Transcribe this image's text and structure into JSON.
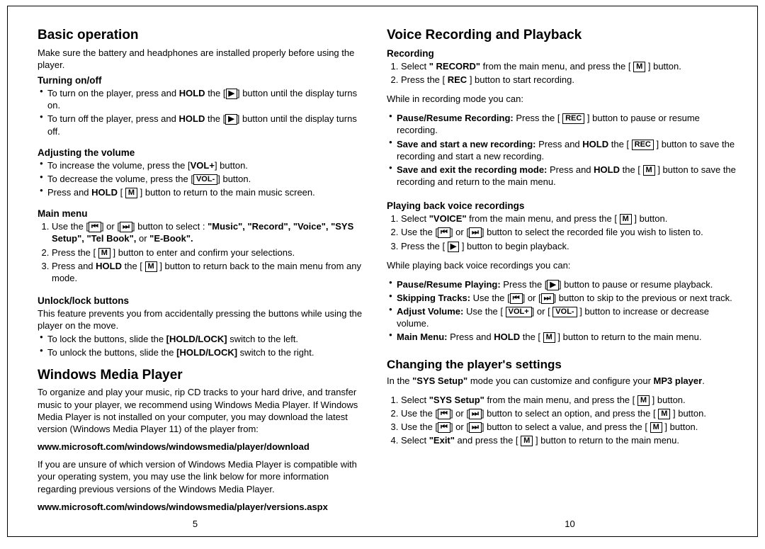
{
  "left": {
    "title": "Basic operation",
    "intro": "Make sure the battery and headphones are installed properly before using the player.",
    "turning_h": "Turning on/off",
    "turning_on_a": "To turn on the player, press and ",
    "turning_on_b": " the [",
    "turning_on_c": "] button until the display turns on.",
    "turning_off_a": "To turn off the player, press and ",
    "turning_off_b": " the [",
    "turning_off_c": "] button until the display turns off.",
    "hold": "HOLD",
    "volume_h": "Adjusting the volume",
    "vol_inc_a": "To increase the volume, press the [",
    "vol_inc_b": "] button.",
    "vol_dec_a": "To decrease the volume, press the [",
    "vol_dec_b": "] button.",
    "vol_plus": "VOL+",
    "vol_minus": "VOL-",
    "vol_hold_a": "Press and ",
    "vol_hold_b": " [ ",
    "vol_hold_c": " ] button to return to the main music screen.",
    "m_btn": "M",
    "mainmenu_h": "Main menu",
    "mm_1a": "Use the [",
    "mm_1b": "] or [",
    "mm_1c": "] button to select : ",
    "mm_1d": "\"Music\", \"Record\", \"Voice\", \"SYS Setup\", \"Tel Book\",",
    "mm_1e": " or ",
    "mm_1f": "\"E-Book\".",
    "mm_2a": "Press the [ ",
    "mm_2b": " ] button to enter and confirm your selections.",
    "mm_3a": "Press and ",
    "mm_3b": " the [ ",
    "mm_3c": " ] button to return back to the main menu from any mode.",
    "lock_h": "Unlock/lock buttons",
    "lock_desc": "This feature prevents you from accidentally pressing the buttons while using the player on the move.",
    "lock_1a": "To lock the buttons, slide the ",
    "lock_1b": "[HOLD/LOCK]",
    "lock_1c": " switch to the left.",
    "lock_2a": "To unlock the buttons, slide the ",
    "lock_2c": " switch to the right.",
    "wmp_h": "Windows Media Player",
    "wmp_p1": "To organize and play your music, rip CD tracks to your hard drive, and transfer music to your player, we recommend using Windows Media Player.  If Windows Media Player is not installed on your computer, you may download the latest version (Windows Media Player 11) of the player from:",
    "wmp_link1": "www.microsoft.com/windows/windowsmedia/player/download",
    "wmp_p2": "If you are unsure of which version of Windows Media Player is compatible with your operating system, you may use the link below for more information regarding previous versions of the Windows Media Player.",
    "wmp_link2": "www.microsoft.com/windows/windowsmedia/player/versions.aspx",
    "page_number": "5"
  },
  "right": {
    "title": "Voice Recording and Playback",
    "rec_h": "Recording",
    "rec_1a": "Select ",
    "rec_1b": "\" RECORD\"",
    "rec_1c": " from the main menu, and press the  [ ",
    "rec_1d": " ] button.",
    "rec_2a": "Press the [ ",
    "rec_2b": "REC",
    "rec_2c": " ] button to start recording.",
    "rec_while": "While in recording mode you can:",
    "rec_b1_h": "Pause/Resume Recording: ",
    "rec_b1_a": "Press the [ ",
    "rec_b1_b": " ] button to pause or resume recording.",
    "rec_b2_h": "Save and start a new recording: ",
    "rec_b2_a": "Press and ",
    "rec_b2_b": " the [ ",
    "rec_b2_c": " ] button to save the recording and start a new recording.",
    "rec_b3_h": "Save and exit the recording mode: ",
    "rec_b3_a": "Press and ",
    "rec_b3_b": " the [ ",
    "rec_b3_c": " ] button to save the recording and return to the main menu.",
    "play_h": "Playing back voice recordings",
    "play_1a": "Select ",
    "play_1b": "\"VOICE\"",
    "play_1c": " from the main menu, and press the [ ",
    "play_1d": " ] button.",
    "play_2a": "Use the [",
    "play_2b": "] or [",
    "play_2c": "] button to select the recorded file you wish to listen to.",
    "play_3a": "Press the [ ",
    "play_3b": " ] button to begin playback.",
    "play_while": "While playing back voice recordings you can:",
    "pb_b1_h": "Pause/Resume Playing: ",
    "pb_b1_a": "Press the [",
    "pb_b1_b": "] button to pause or resume playback.",
    "pb_b2_h": "Skipping Tracks: ",
    "pb_b2_a": "Use the [",
    "pb_b2_b": "] or [",
    "pb_b2_c": "] button to skip to the previous or next track.",
    "pb_b3_h": "Adjust Volume: ",
    "pb_b3_a": "Use the [ ",
    "pb_b3_b": "] or [ ",
    "pb_b3_c": " ] button to increase or decrease volume.",
    "pb_b4_h": "Main Menu: ",
    "pb_b4_a": "Press and ",
    "pb_b4_b": " the [ ",
    "pb_b4_c": " ] button to return to the main menu.",
    "settings_h": "Changing the player's settings",
    "set_intro_a": "In the ",
    "set_intro_b": "\"SYS Setup\"",
    "set_intro_c": " mode you can customize and configure your ",
    "set_intro_d": "MP3 player",
    "set_intro_e": ".",
    "set_1a": "Select ",
    "set_1b": "\"SYS Setup\"",
    "set_1c": " from the main menu, and press the [ ",
    "set_1d": " ] button.",
    "set_2a": "Use the [",
    "set_2b": "] or [",
    "set_2c": "] button to select an option, and press the [ ",
    "set_2d": " ] button.",
    "set_3a": "Use the [",
    "set_3b": "] or [",
    "set_3c": "] button to select a value, and press the [ ",
    "set_3d": " ] button.",
    "set_4a": "Select ",
    "set_4b": "\"Exit\"",
    "set_4c": " and press the [ ",
    "set_4d": " ] button to return to the main menu.",
    "page_number": "10"
  },
  "icons": {
    "play": "▶",
    "prev": "⏮",
    "next": "⏭"
  }
}
